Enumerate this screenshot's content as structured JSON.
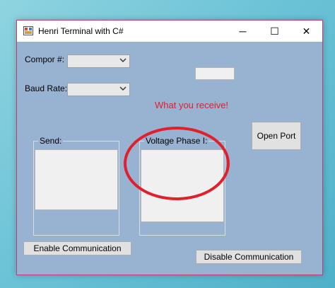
{
  "window": {
    "title": "Henri Terminal with C#",
    "controls": {
      "minimize": "─",
      "maximize": "☐",
      "close": "✕"
    }
  },
  "form": {
    "comport_label": "Compor #:",
    "comport_value": "",
    "baud_label": "Baud Rate:",
    "baud_value": "",
    "status_box_value": "",
    "open_port_label": "Open Port",
    "send_group_label": "Send:",
    "send_text": "",
    "voltage_group_label": "Voltage Phase I:",
    "voltage_text": "",
    "enable_button_label": "Enable Communication",
    "disable_button_label": "Disable Communication"
  },
  "annotation": {
    "note_text": "What you receive!",
    "color": "#e0202a"
  },
  "colors": {
    "form_background": "#98b2d1",
    "desktop_background": "#6cc3d6",
    "window_border": "#c73b73"
  }
}
